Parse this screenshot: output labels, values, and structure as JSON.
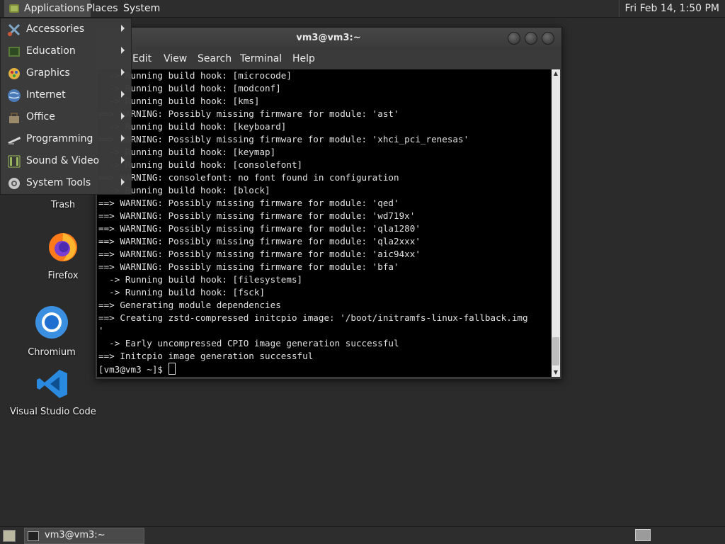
{
  "top_panel": {
    "applications": "Applications",
    "places": "Places",
    "system": "System",
    "clock": "Fri Feb 14,  1:50 PM"
  },
  "apps_menu": {
    "items": [
      {
        "label": "Accessories",
        "icon": "accessories-icon"
      },
      {
        "label": "Education",
        "icon": "education-icon"
      },
      {
        "label": "Graphics",
        "icon": "graphics-icon"
      },
      {
        "label": "Internet",
        "icon": "internet-icon"
      },
      {
        "label": "Office",
        "icon": "office-icon"
      },
      {
        "label": "Programming",
        "icon": "programming-icon"
      },
      {
        "label": "Sound & Video",
        "icon": "sound-video-icon"
      },
      {
        "label": "System Tools",
        "icon": "system-tools-icon"
      }
    ]
  },
  "desktop": {
    "icons": [
      {
        "label": "Trash",
        "icon": "trash-icon"
      },
      {
        "label": "Firefox",
        "icon": "firefox-icon"
      },
      {
        "label": "Chromium",
        "icon": "chromium-icon"
      },
      {
        "label": "Visual Studio Code",
        "icon": "vscode-icon"
      }
    ]
  },
  "terminal": {
    "title": "vm3@vm3:~",
    "menu": [
      "Edit",
      "View",
      "Search",
      "Terminal",
      "Help"
    ],
    "lines": [
      "  -> Running build hook: [microcode]",
      "  -> Running build hook: [modconf]",
      "  -> Running build hook: [kms]",
      "==> WARNING: Possibly missing firmware for module: 'ast'",
      "  -> Running build hook: [keyboard]",
      "==> WARNING: Possibly missing firmware for module: 'xhci_pci_renesas'",
      "  -> Running build hook: [keymap]",
      "  -> Running build hook: [consolefont]",
      "==> WARNING: consolefont: no font found in configuration",
      "  -> Running build hook: [block]",
      "==> WARNING: Possibly missing firmware for module: 'qed'",
      "==> WARNING: Possibly missing firmware for module: 'wd719x'",
      "==> WARNING: Possibly missing firmware for module: 'qla1280'",
      "==> WARNING: Possibly missing firmware for module: 'qla2xxx'",
      "==> WARNING: Possibly missing firmware for module: 'aic94xx'",
      "==> WARNING: Possibly missing firmware for module: 'bfa'",
      "  -> Running build hook: [filesystems]",
      "  -> Running build hook: [fsck]",
      "==> Generating module dependencies",
      "==> Creating zstd-compressed initcpio image: '/boot/initramfs-linux-fallback.img",
      "'",
      "  -> Early uncompressed CPIO image generation successful",
      "==> Initcpio image generation successful"
    ],
    "prompt": "[vm3@vm3 ~]$ "
  },
  "bottom_panel": {
    "task_label": "vm3@vm3:~"
  },
  "colors": {
    "panel_bg": "#2d2d2d",
    "desktop_bg": "#2b2b2b",
    "terminal_bg": "#000000"
  }
}
